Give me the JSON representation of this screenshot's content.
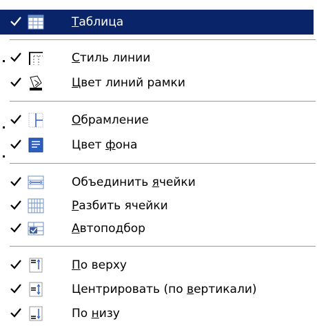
{
  "menu": {
    "items": [
      {
        "pre": "",
        "u": "Т",
        "post": "аблица",
        "checked": true,
        "icon": "table-icon",
        "highlighted": true
      },
      {
        "pre": "",
        "u": "С",
        "post": "тиль линии",
        "checked": true,
        "icon": "line-style-icon"
      },
      {
        "pre": "",
        "u": "Ц",
        "post": "вет линий рамки",
        "checked": true,
        "icon": "border-color-icon"
      },
      {
        "pre": "",
        "u": "О",
        "post": "брамление",
        "checked": true,
        "icon": "borders-icon"
      },
      {
        "pre": "Цвет ",
        "u": "ф",
        "post": "она",
        "checked": true,
        "icon": "shading-color-icon"
      },
      {
        "pre": "Объединить ",
        "u": "я",
        "post": "чейки",
        "checked": true,
        "icon": "merge-cells-icon"
      },
      {
        "pre": "",
        "u": "Р",
        "post": "азбить ячейки",
        "checked": true,
        "icon": "split-cells-icon"
      },
      {
        "pre": "",
        "u": "А",
        "post": "втоподбор",
        "checked": true,
        "icon": "autofit-icon"
      },
      {
        "pre": "",
        "u": "П",
        "post": "о верху",
        "checked": true,
        "icon": "align-top-icon"
      },
      {
        "pre": "Центрировать (по ",
        "u": "в",
        "post": "ертикали)",
        "checked": true,
        "icon": "align-middle-icon"
      },
      {
        "pre": "По ",
        "u": "н",
        "post": "изу",
        "checked": true,
        "icon": "align-bottom-icon"
      }
    ],
    "highlight_color": "#0a246a"
  }
}
